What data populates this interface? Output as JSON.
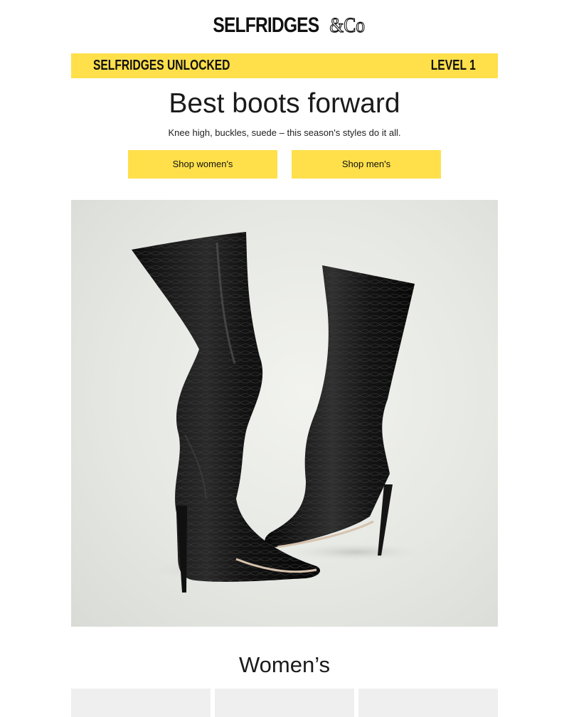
{
  "brand": {
    "name": "SELFRIDGES",
    "suffix": "&Co"
  },
  "banner": {
    "program": "SELFRIDGES UNLOCKED",
    "level": "LEVEL 1",
    "color": "#ffe04b"
  },
  "hero_text": {
    "title": "Best boots forward",
    "subtitle": "Knee high, buckles, suede – this season's styles do it all."
  },
  "buttons": {
    "women": "Shop women's",
    "men": "Shop men's"
  },
  "hero_image": {
    "icon": "black-croc-knee-high-stiletto-boots"
  },
  "sections": {
    "womens_title": "Women’s"
  }
}
